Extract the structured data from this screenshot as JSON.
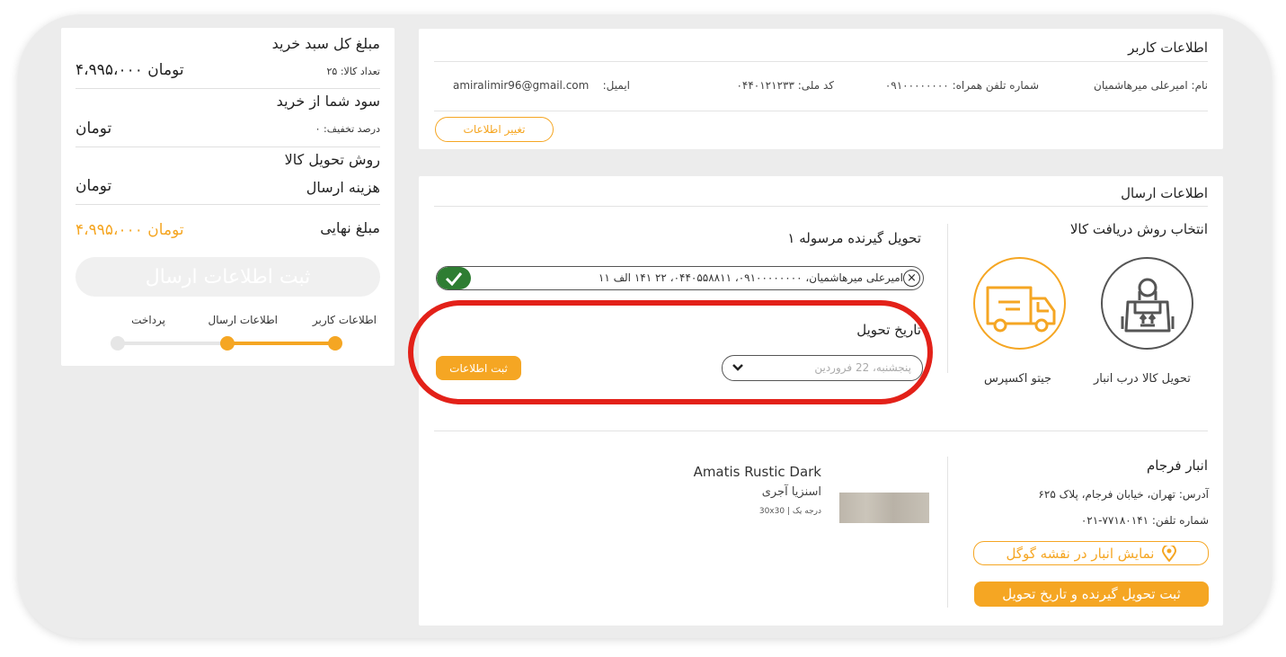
{
  "summary": {
    "cart_total_title": "مبلغ کل سبد خرید",
    "cart_total_amount": "۴،۹۹۵،۰۰۰  تومان",
    "item_count": "تعداد کالا: ۲۵",
    "profit_title": "سود شما از خرید",
    "discount_percent": "درصد تخفیف: ۰",
    "profit_amount": "تومان",
    "delivery_method_title": "روش تحویل کالا",
    "shipping_cost_label": "هزینه ارسال",
    "shipping_cost_amount": "تومان",
    "final_label": "مبلغ نهایی",
    "final_amount": "۴،۹۹۵،۰۰۰  تومان",
    "submit_label": "ثبت اطلاعات ارسال",
    "steps": [
      {
        "label": "اطلاعات کاربر",
        "done": true
      },
      {
        "label": "اطلاعات ارسال",
        "done": true
      },
      {
        "label": "پرداخت",
        "done": false
      }
    ]
  },
  "user_info": {
    "title": "اطلاعات کاربر",
    "name": "نام: امیرعلی میرهاشمیان",
    "mobile": "شماره تلفن همراه: ۰۹۱۰۰۰۰۰۰۰۰",
    "national_code": "کد ملی: ۰۴۴۰۱۲۱۲۳۳",
    "email_label": "ایمیل:",
    "email_value": "amiralimir96@gmail.com",
    "edit_button": "تغییر اطلاعات"
  },
  "shipping": {
    "title": "اطلاعات ارسال",
    "method_title": "انتخاب روش دریافت کالا",
    "methods": [
      {
        "label": "تحویل کالا درب انبار",
        "icon": "warehouse-package-icon",
        "selected": false
      },
      {
        "label": "جیتو اکسپرس",
        "icon": "delivery-truck-icon",
        "selected": true
      }
    ],
    "recipient_title": "تحویل گیرنده مرسوله ۱",
    "recipient_value": "امیرعلی میرهاشمیان، ۰۹۱۰۰۰۰۰۰۰۰، ۰۴۴۰۵۵۸۸۱۱، ۲۲ ۱۴۱ الف ۱۱",
    "date_title": "تاریخ تحویل",
    "date_value": "پنجشنبه، 22 فروردین",
    "date_submit": "ثبت اطلاعات",
    "warehouse": {
      "name": "انبار فرجام",
      "address": "آدرس: تهران، خیابان فرجام، پلاک ۶۲۵",
      "phone": "شماره تلفن: ۷۷۱۸۰۱۴۱-۰۲۱",
      "map_button": "نمایش انبار در نقشه گوگل",
      "submit_button": "ثبت تحویل گیرنده و تاریخ تحویل"
    },
    "product": {
      "name_en": "Amatis Rustic Dark",
      "name_fa": "اسنزیا آجری",
      "grade": "درجه یک | 30x30"
    }
  },
  "colors": {
    "accent": "#f5a623",
    "highlight_ring": "#e32119",
    "check_green": "#2e7d32",
    "icon_gray": "#555555"
  }
}
